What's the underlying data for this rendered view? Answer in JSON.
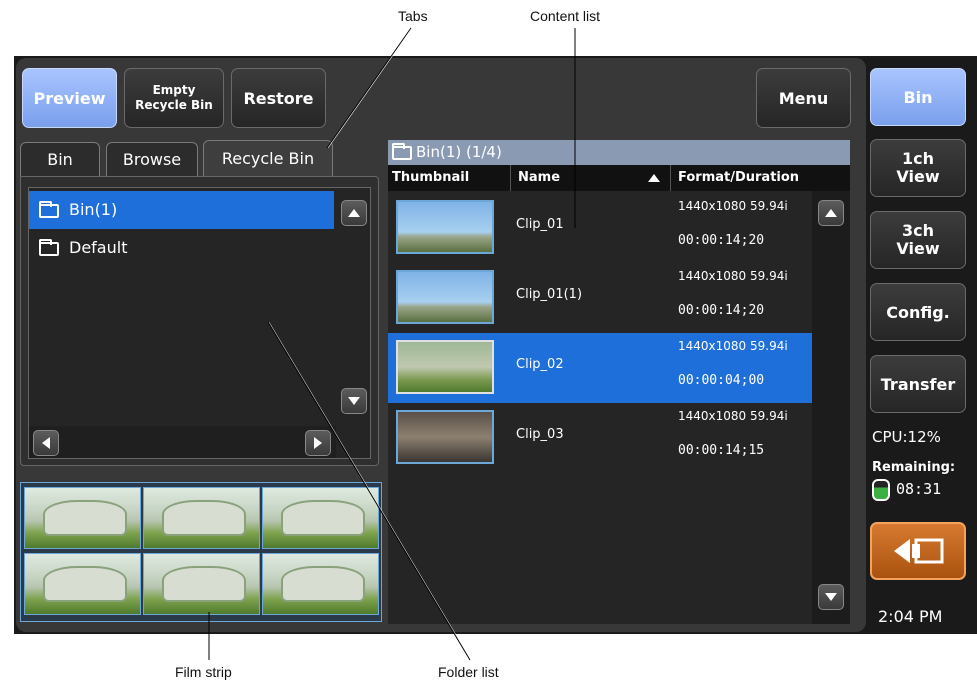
{
  "callouts": {
    "tabs": "Tabs",
    "content_list": "Content list",
    "film_strip": "Film strip",
    "folder_list": "Folder list"
  },
  "toolbar": {
    "preview": "Preview",
    "empty_recycle_bin_line1": "Empty",
    "empty_recycle_bin_line2": "Recycle Bin",
    "restore": "Restore",
    "menu": "Menu"
  },
  "tabs": [
    "Bin",
    "Browse",
    "Recycle Bin"
  ],
  "folders": [
    {
      "name": "Bin(1)",
      "selected": true
    },
    {
      "name": "Default",
      "selected": false
    }
  ],
  "content": {
    "header": "Bin(1) (1/4)",
    "columns": {
      "thumbnail": "Thumbnail",
      "name": "Name",
      "format": "Format/Duration"
    },
    "clips": [
      {
        "name": "Clip_01",
        "format": "1440x1080 59.94i",
        "duration": "00:00:14;20",
        "selected": false
      },
      {
        "name": "Clip_01(1)",
        "format": "1440x1080 59.94i",
        "duration": "00:00:14;20",
        "selected": false
      },
      {
        "name": "Clip_02",
        "format": "1440x1080 59.94i",
        "duration": "00:00:04;00",
        "selected": true
      },
      {
        "name": "Clip_03",
        "format": "1440x1080 59.94i",
        "duration": "00:00:14;15",
        "selected": false
      }
    ]
  },
  "sidebar": {
    "bin": "Bin",
    "ch1_line1": "1ch",
    "ch1_line2": "View",
    "ch3_line1": "3ch",
    "ch3_line2": "View",
    "config": "Config.",
    "transfer": "Transfer",
    "cpu": "CPU:12%",
    "remaining_label": "Remaining:",
    "remaining_value": "08:31",
    "time": "2:04 PM"
  },
  "colors": {
    "selection": "#1e6fd9",
    "accent_button": "#8aaaf0",
    "back_button": "#c0621a"
  }
}
